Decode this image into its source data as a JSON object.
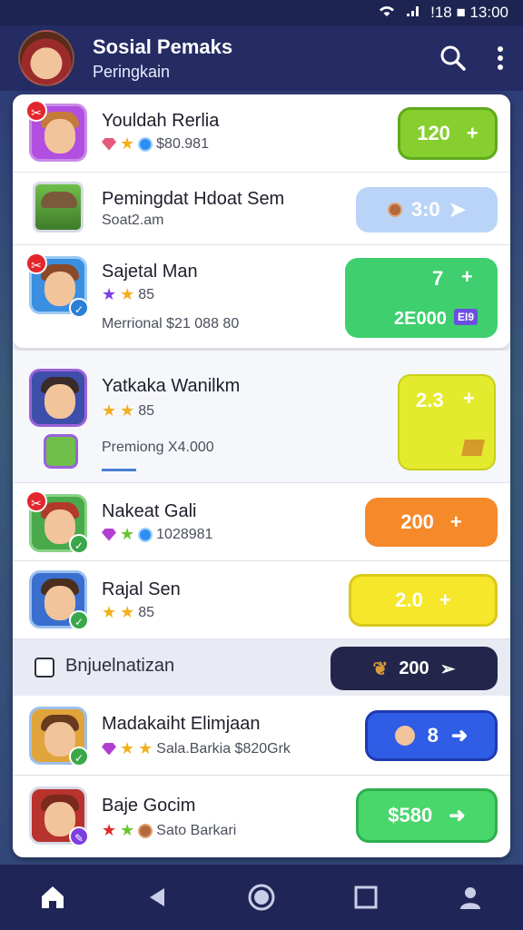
{
  "status_bar": {
    "text": "!18 ■ 13:00"
  },
  "header": {
    "title": "Sosial Pemaks",
    "subtitle": "Peringkain"
  },
  "rows": [
    {
      "name": "Youldah Rerlia",
      "meta": "$80.981",
      "button": "120",
      "button_color": "#86cf2f"
    },
    {
      "name": "Pemingdat Hdoat Sem",
      "meta": "Soat2.am",
      "button": "3:0",
      "button_color": "#b9d4f7"
    },
    {
      "name": "Sajetal Man",
      "meta": "85",
      "sub": "Merrional $21 088 80",
      "button": "7",
      "button_sub": "2E000",
      "button_tag": "EI9",
      "button_color": "#3fcf6e"
    },
    {
      "name": "Yatkaka Wanilkm",
      "meta": "85",
      "sub": "Premiong X4.000",
      "button": "2.3",
      "button_color": "#e4ea2e"
    },
    {
      "name": "Nakeat Gali",
      "meta": "1028981",
      "button": "200",
      "button_color": "#f6892a"
    },
    {
      "name": "Rajal Sen",
      "meta": "85",
      "button": "2.0",
      "button_color": "#f6e72a"
    },
    {
      "name": "Madakaiht Elimjaan",
      "meta": "Sala.Barkia $820Grk",
      "button": "8",
      "button_color": "#2f5de5"
    },
    {
      "name": "Baje Gocim",
      "meta": "Sato Barkari",
      "button": "$580",
      "button_color": "#49d66b"
    }
  ],
  "divider": {
    "label": "Bnjuelnatizan",
    "button": "200"
  },
  "colors": {
    "header_bg": "#252b63",
    "panel_bg": "#f3f5fa",
    "nav_bg": "#1f2556"
  }
}
